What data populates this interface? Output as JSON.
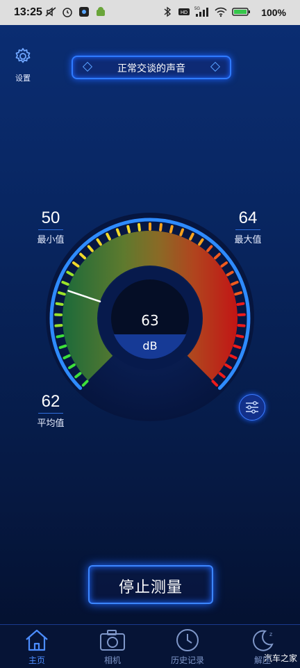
{
  "status_bar": {
    "time": "13:25",
    "battery": "100%",
    "network": "5G"
  },
  "settings": {
    "label": "设置",
    "icon": "gear-icon"
  },
  "mode": {
    "label": "正常交谈的声音"
  },
  "stats": {
    "min": {
      "value": "50",
      "label": "最小值"
    },
    "max": {
      "value": "64",
      "label": "最大值"
    },
    "avg": {
      "value": "62",
      "label": "平均值"
    }
  },
  "meter": {
    "value": "63",
    "unit": "dB",
    "level": 63,
    "scale_min": 0,
    "scale_max": 120
  },
  "stop_button": {
    "label": "停止测量"
  },
  "nav": {
    "items": [
      {
        "label": "主页",
        "icon": "home-icon",
        "active": true
      },
      {
        "label": "相机",
        "icon": "camera-icon",
        "active": false
      },
      {
        "label": "历史记录",
        "icon": "clock-icon",
        "active": false
      },
      {
        "label": "解压",
        "icon": "moon-icon",
        "active": false
      }
    ]
  },
  "watermark": "汽车之家",
  "colors": {
    "accent": "#2f7bff",
    "active_nav": "#4c8dff",
    "inactive_nav": "#7f97c9"
  }
}
